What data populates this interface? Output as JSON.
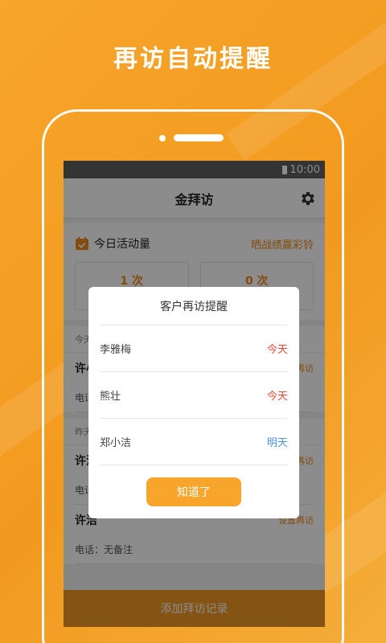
{
  "headline": "再访自动提醒",
  "status_bar": {
    "time": "10:00"
  },
  "app": {
    "title": "金拜访",
    "settings_icon": "gear-icon"
  },
  "activity": {
    "title": "今日活动量",
    "promo_link": "晒战绩赢彩铃",
    "stats": [
      "1 次",
      "0 次"
    ]
  },
  "visits": {
    "sections": [
      {
        "date": "今天",
        "items": [
          {
            "name": "许小",
            "action": "再访",
            "phone": "电话"
          }
        ]
      },
      {
        "date": "昨天",
        "items": [
          {
            "name": "许洁",
            "action": "再访",
            "phone": "电话"
          },
          {
            "name": "许洁",
            "action": "设置再访",
            "phone": "电话：无备注"
          }
        ]
      }
    ]
  },
  "add_visit_button": "添加拜访记录",
  "dialog": {
    "title": "客户再访提醒",
    "reminders": [
      {
        "name": "李雅梅",
        "when": "今天",
        "type": "today"
      },
      {
        "name": "熊壮",
        "when": "今天",
        "type": "today"
      },
      {
        "name": "郑小洁",
        "when": "明天",
        "type": "tomorrow"
      }
    ],
    "confirm_label": "知道了"
  },
  "colors": {
    "accent": "#f7a52b",
    "today": "#e8463c",
    "tomorrow": "#4a90e2"
  }
}
